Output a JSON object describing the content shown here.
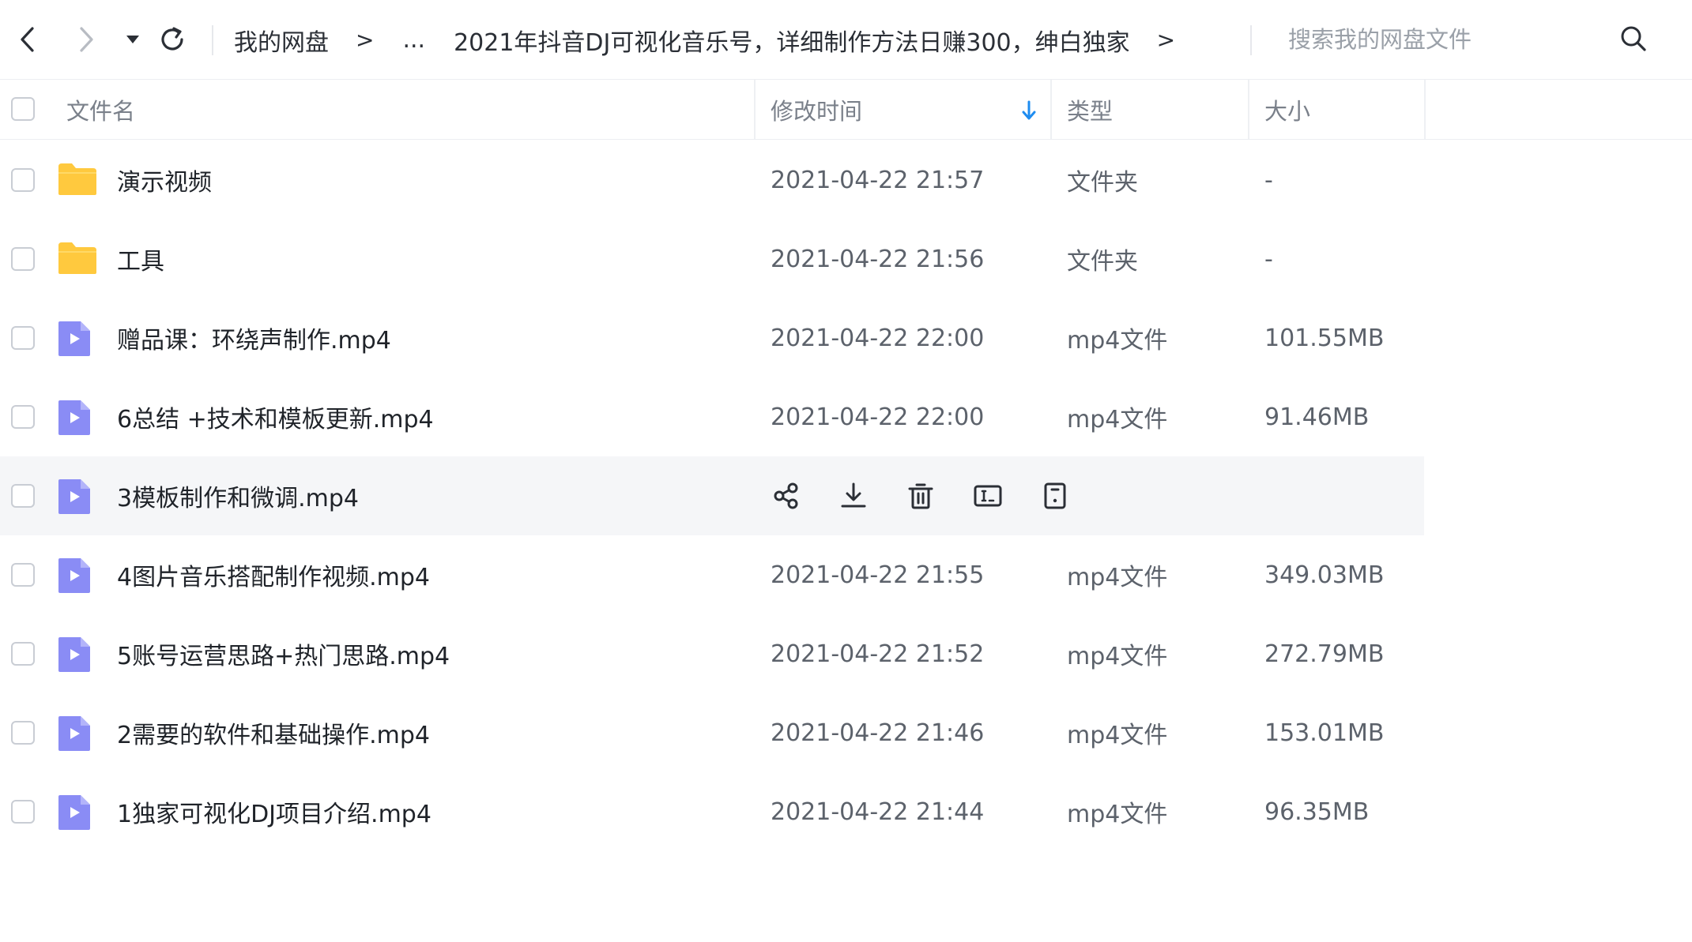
{
  "nav": {
    "back": "back-icon",
    "forward": "forward-icon",
    "dropdown": "caret-down-icon",
    "refresh": "refresh-icon"
  },
  "breadcrumb": {
    "root": "我的网盘",
    "ellipsis": "...",
    "current": "2021年抖音DJ可视化音乐号，详细制作方法日赚300，绅白独家",
    "separator": ">"
  },
  "search": {
    "placeholder": "搜索我的网盘文件",
    "icon": "search-icon"
  },
  "columns": {
    "name": "文件名",
    "modified": "修改时间",
    "type": "类型",
    "size": "大小"
  },
  "colors": {
    "folder": "#ffc93e",
    "video": "#8a8cf5",
    "accent": "#1e8cf0",
    "hover_row": "#f5f6f8"
  },
  "files": [
    {
      "name": "演示视频",
      "modified": "2021-04-22 21:57",
      "type": "文件夹",
      "size": "-",
      "icon": "folder-icon"
    },
    {
      "name": "工具",
      "modified": "2021-04-22 21:56",
      "type": "文件夹",
      "size": "-",
      "icon": "folder-icon"
    },
    {
      "name": "赠品课：环绕声制作.mp4",
      "modified": "2021-04-22 22:00",
      "type": "mp4文件",
      "size": "101.55MB",
      "icon": "video-file-icon"
    },
    {
      "name": "6总结 +技术和模板更新.mp4",
      "modified": "2021-04-22 22:00",
      "type": "mp4文件",
      "size": "91.46MB",
      "icon": "video-file-icon"
    },
    {
      "name": "3模板制作和微调.mp4",
      "modified": "",
      "type": "",
      "size": "",
      "icon": "video-file-icon",
      "hovered": true
    },
    {
      "name": "4图片音乐搭配制作视频.mp4",
      "modified": "2021-04-22 21:55",
      "type": "mp4文件",
      "size": "349.03MB",
      "icon": "video-file-icon"
    },
    {
      "name": "5账号运营思路+热门思路.mp4",
      "modified": "2021-04-22 21:52",
      "type": "mp4文件",
      "size": "272.79MB",
      "icon": "video-file-icon"
    },
    {
      "name": "2需要的软件和基础操作.mp4",
      "modified": "2021-04-22 21:46",
      "type": "mp4文件",
      "size": "153.01MB",
      "icon": "video-file-icon"
    },
    {
      "name": "1独家可视化DJ项目介绍.mp4",
      "modified": "2021-04-22 21:44",
      "type": "mp4文件",
      "size": "96.35MB",
      "icon": "video-file-icon"
    }
  ],
  "row_actions": [
    "share-icon",
    "download-icon",
    "delete-icon",
    "rename-icon",
    "more-file-icon"
  ]
}
